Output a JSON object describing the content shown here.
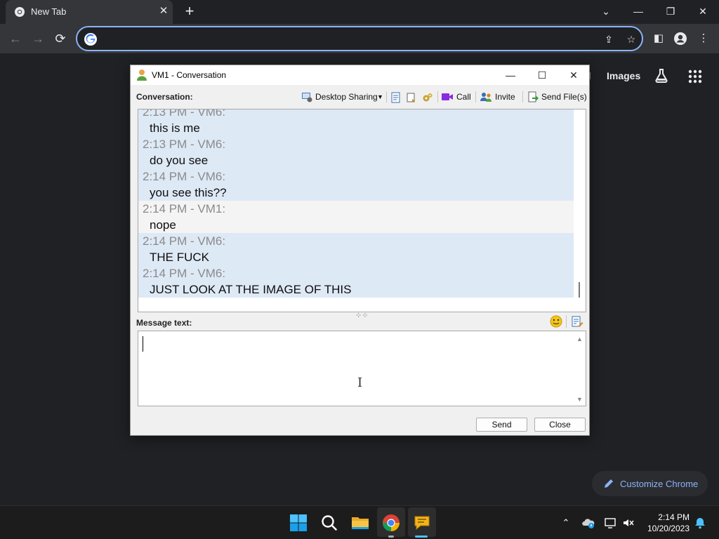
{
  "browser": {
    "tab_title": "New Tab",
    "tab_close": "✕",
    "new_tab": "+",
    "window_controls": {
      "dropdown": "⌄",
      "minimize": "—",
      "restore": "❐",
      "close": "✕"
    },
    "address_value": "",
    "address_placeholder": ""
  },
  "page": {
    "links": [
      "ail",
      "Images"
    ],
    "customize_label": "Customize Chrome",
    "accent": "#8ab4f8"
  },
  "dialog": {
    "title": "VM1 - Conversation",
    "conversation_label": "Conversation:",
    "toolbar": {
      "desktop_sharing": "Desktop Sharing",
      "call": "Call",
      "invite": "Invite",
      "send_files": "Send File(s)"
    },
    "messages": [
      {
        "meta": "2:13 PM - VM6:",
        "text": "this is me",
        "sender": "VM6"
      },
      {
        "meta": "2:13 PM - VM6:",
        "text": "do you see",
        "sender": "VM6"
      },
      {
        "meta": "2:14 PM - VM6:",
        "text": "you see this??",
        "sender": "VM6"
      },
      {
        "meta": "2:14 PM - VM1:",
        "text": "nope",
        "sender": "VM1"
      },
      {
        "meta": "2:14 PM - VM6:",
        "text": "THE FUCK",
        "sender": "VM6"
      },
      {
        "meta": "2:14 PM - VM6:",
        "text": "JUST LOOK AT THE IMAGE OF THIS",
        "sender": "VM6"
      }
    ],
    "splitter": "⁘⁘",
    "message_label": "Message text:",
    "message_value": "",
    "send_label": "Send",
    "close_label": "Close"
  },
  "taskbar": {
    "time": "2:14 PM",
    "date": "10/20/2023"
  }
}
